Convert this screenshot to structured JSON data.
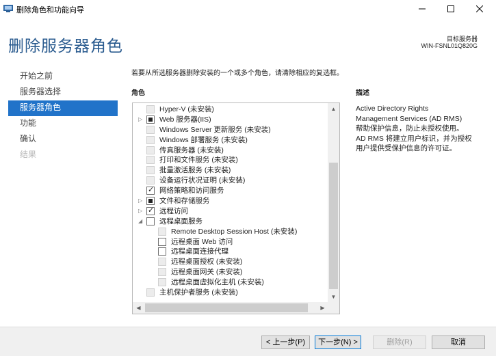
{
  "window": {
    "title": "删除角色和功能向导",
    "minimize_icon": "minimize-icon",
    "maximize_icon": "maximize-icon",
    "close_icon": "close-icon"
  },
  "header": {
    "title": "删除服务器角色",
    "target_label": "目标服务器",
    "target_value": "WIN-FSNL01Q820G"
  },
  "nav": {
    "items": [
      {
        "label": "开始之前",
        "state": "normal"
      },
      {
        "label": "服务器选择",
        "state": "normal"
      },
      {
        "label": "服务器角色",
        "state": "active"
      },
      {
        "label": "功能",
        "state": "normal"
      },
      {
        "label": "确认",
        "state": "normal"
      },
      {
        "label": "结果",
        "state": "disabled"
      }
    ]
  },
  "main": {
    "instruction": "若要从所选服务器删除安装的一个或多个角色，请清除相应的复选框。",
    "roles_label": "角色",
    "description_label": "描述",
    "description_lines": [
      "Active Directory Rights",
      "Management Services (AD RMS)",
      "帮助保护信息，防止未授权使用。",
      "AD RMS 将建立用户标识，并为授权",
      "用户提供受保护信息的许可证。"
    ],
    "roles": [
      {
        "label": "Hyper-V (未安装)",
        "level": 0,
        "expander": "",
        "check": "disabled"
      },
      {
        "label": "Web 服务器(IIS)",
        "level": 0,
        "expander": "▷",
        "check": "partial"
      },
      {
        "label": "Windows Server 更新服务 (未安装)",
        "level": 0,
        "expander": "",
        "check": "disabled"
      },
      {
        "label": "Windows 部署服务 (未安装)",
        "level": 0,
        "expander": "",
        "check": "disabled"
      },
      {
        "label": "传真服务器 (未安装)",
        "level": 0,
        "expander": "",
        "check": "disabled"
      },
      {
        "label": "打印和文件服务 (未安装)",
        "level": 0,
        "expander": "",
        "check": "disabled"
      },
      {
        "label": "批量激活服务 (未安装)",
        "level": 0,
        "expander": "",
        "check": "disabled"
      },
      {
        "label": "设备运行状况证明 (未安装)",
        "level": 0,
        "expander": "",
        "check": "disabled"
      },
      {
        "label": "网络策略和访问服务",
        "level": 0,
        "expander": "",
        "check": "checked"
      },
      {
        "label": "文件和存储服务",
        "level": 0,
        "expander": "▷",
        "check": "partial"
      },
      {
        "label": "远程访问",
        "level": 0,
        "expander": "▷",
        "check": "checked"
      },
      {
        "label": "远程桌面服务",
        "level": 0,
        "expander": "◢",
        "check": "unchecked"
      },
      {
        "label": "Remote Desktop Session Host (未安装)",
        "level": 1,
        "expander": "",
        "check": "disabled"
      },
      {
        "label": "远程桌面 Web 访问",
        "level": 1,
        "expander": "",
        "check": "unchecked"
      },
      {
        "label": "远程桌面连接代理",
        "level": 1,
        "expander": "",
        "check": "unchecked"
      },
      {
        "label": "远程桌面授权 (未安装)",
        "level": 1,
        "expander": "",
        "check": "disabled"
      },
      {
        "label": "远程桌面网关 (未安装)",
        "level": 1,
        "expander": "",
        "check": "disabled"
      },
      {
        "label": "远程桌面虚拟化主机 (未安装)",
        "level": 1,
        "expander": "",
        "check": "disabled"
      },
      {
        "label": "主机保护者服务 (未安装)",
        "level": 0,
        "expander": "",
        "check": "disabled"
      }
    ]
  },
  "footer": {
    "prev": "< 上一步(P)",
    "next": "下一步(N) >",
    "remove": "删除(R)",
    "cancel": "取消"
  },
  "colors": {
    "accent": "#2173c9",
    "title": "#2a5b8f"
  }
}
